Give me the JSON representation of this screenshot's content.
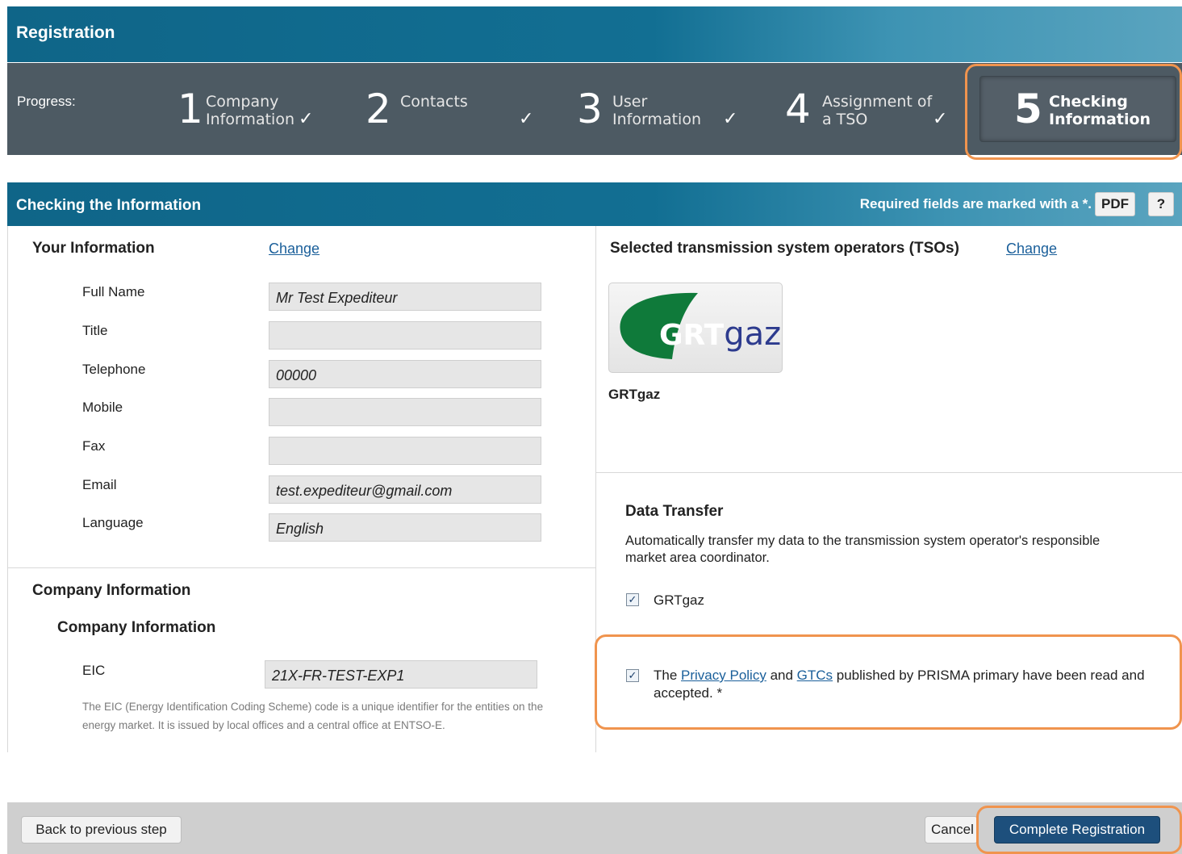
{
  "header": {
    "title": "Registration"
  },
  "progress": {
    "label": "Progress:",
    "steps": [
      {
        "number": "1",
        "label": "Company\nInformation",
        "check": "✓"
      },
      {
        "number": "2",
        "label": "Contacts",
        "check": "✓"
      },
      {
        "number": "3",
        "label": "User\nInformation",
        "check": "✓"
      },
      {
        "number": "4",
        "label": "Assignment of\na TSO",
        "check": "✓"
      },
      {
        "number": "5",
        "label": "Checking\nInformation"
      }
    ],
    "active_step": 5
  },
  "section": {
    "title": "Checking the Information",
    "required_note": "Required fields are marked with a *.",
    "pdf_label": "PDF",
    "help_label": "?"
  },
  "your_info": {
    "heading": "Your Information",
    "change_label": "Change",
    "fields": [
      {
        "label": "Full Name",
        "value": "Mr Test Expediteur"
      },
      {
        "label": "Title",
        "value": ""
      },
      {
        "label": "Telephone",
        "value": "00000"
      },
      {
        "label": "Mobile",
        "value": ""
      },
      {
        "label": "Fax",
        "value": ""
      },
      {
        "label": "Email",
        "value": "test.expediteur@gmail.com"
      },
      {
        "label": "Language",
        "value": "English"
      }
    ]
  },
  "company": {
    "heading": "Company Information",
    "subheading": "Company Information",
    "eic_label": "EIC",
    "eic_value": "21X-FR-TEST-EXP1",
    "eic_help": "The EIC (Energy Identification Coding Scheme) code is a unique identifier for the entities on the energy market. It is issued by local offices and a central office at ENTSO-E."
  },
  "tso": {
    "heading": "Selected transmission system operators (TSOs)",
    "change_label": "Change",
    "logo_text_bold": "GRT",
    "logo_text_light": "gaz",
    "name": "GRTgaz"
  },
  "data_transfer": {
    "heading": "Data Transfer",
    "description": "Automatically transfer my data to the transmission system operator's responsible market area coordinator.",
    "option_label": "GRTgaz",
    "option_checked": true
  },
  "privacy": {
    "checked": true,
    "text_before": "The ",
    "privacy_link": "Privacy Policy",
    "text_mid": " and ",
    "gtc_link": "GTCs",
    "text_after": " published by PRISMA primary have been read and accepted. *"
  },
  "footer": {
    "back_label": "Back to previous step",
    "cancel_label": "Cancel",
    "complete_label": "Complete Registration"
  },
  "colors": {
    "header_blue": "#0f6588",
    "progress_gray": "#4d5a63",
    "highlight_orange": "#f0944e",
    "primary_button": "#1d4f7c"
  }
}
